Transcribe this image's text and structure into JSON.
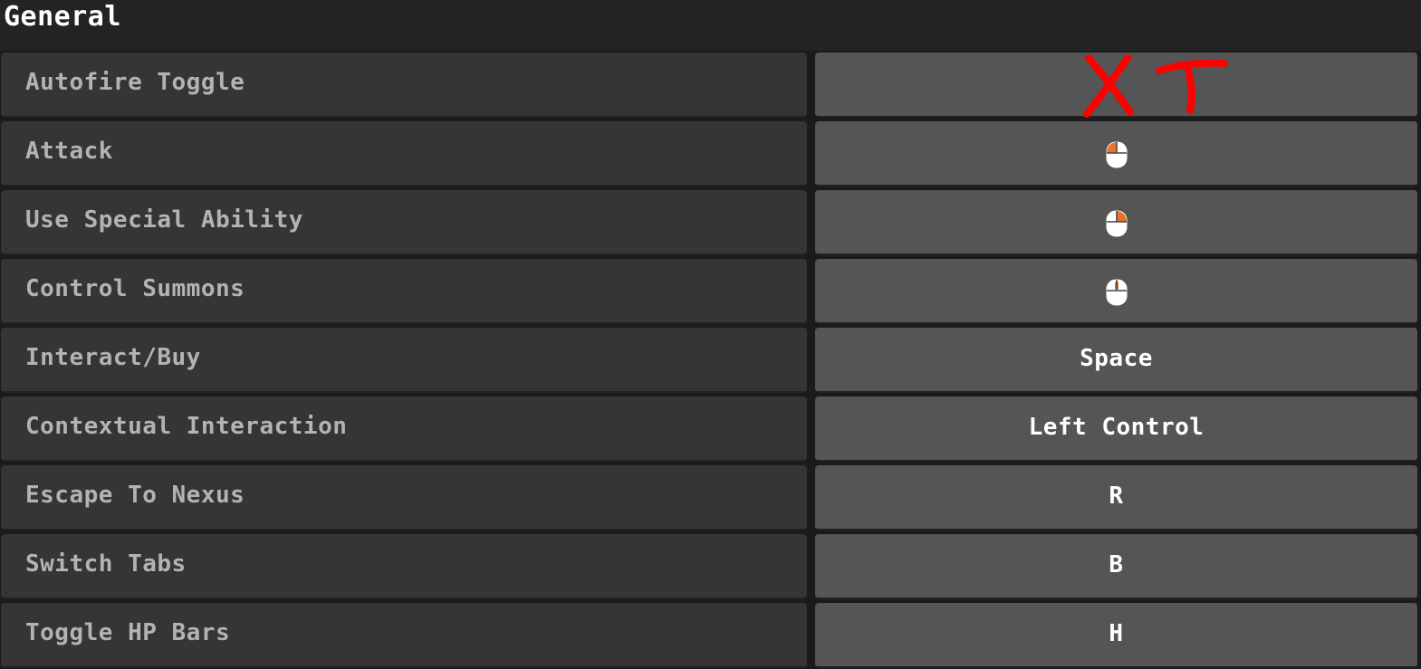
{
  "section": {
    "title": "General"
  },
  "bindings": [
    {
      "action": "Autofire Toggle",
      "key": "",
      "icon": "none"
    },
    {
      "action": "Attack",
      "key": "",
      "icon": "mouse-left-click-icon"
    },
    {
      "action": "Use Special Ability",
      "key": "",
      "icon": "mouse-right-click-icon"
    },
    {
      "action": "Control Summons",
      "key": "",
      "icon": "mouse-middle-click-icon"
    },
    {
      "action": "Interact/Buy",
      "key": "Space",
      "icon": "none"
    },
    {
      "action": "Contextual Interaction",
      "key": "Left Control",
      "icon": "none"
    },
    {
      "action": "Escape To Nexus",
      "key": "R",
      "icon": "none"
    },
    {
      "action": "Switch Tabs",
      "key": "B",
      "icon": "none"
    },
    {
      "action": "Toggle HP Bars",
      "key": "H",
      "icon": "none"
    }
  ],
  "annotation": {
    "text": "XT",
    "color": "#ff0000"
  },
  "colors": {
    "label_cell": "#353535",
    "key_cell": "#555555",
    "label_text": "#b3b3b3",
    "key_text": "#ffffff",
    "mouse_highlight": "#e8732c"
  }
}
